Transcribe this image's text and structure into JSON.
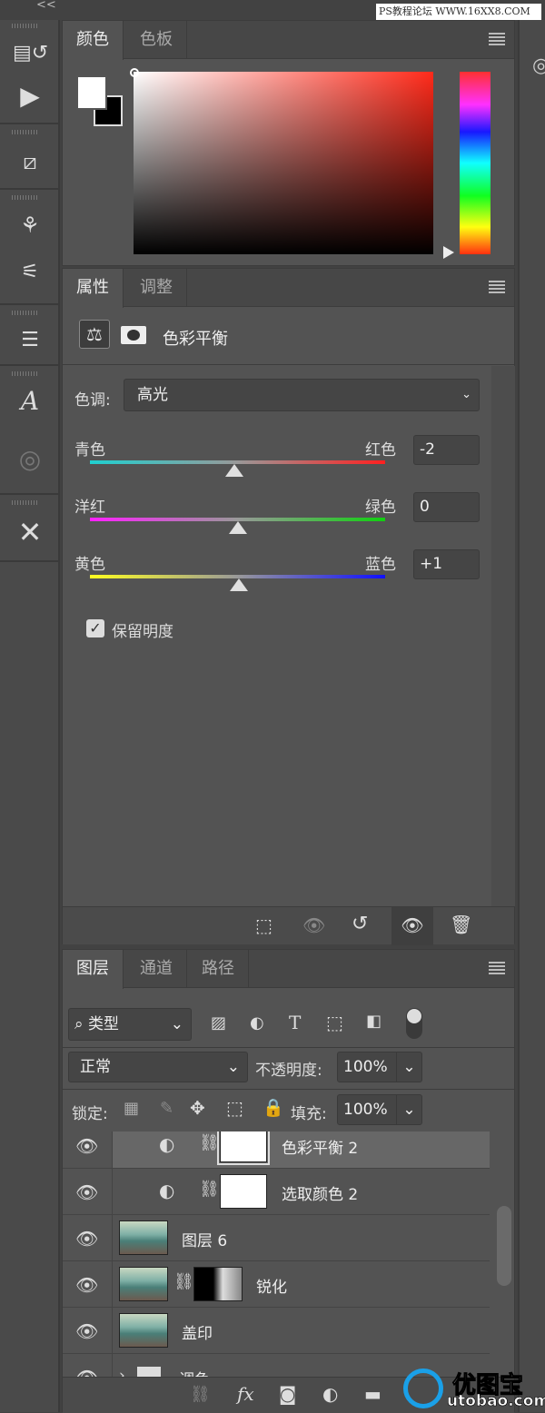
{
  "watermark_top": "PS教程论坛 WWW.16XX8.COM",
  "watermark_bottom": {
    "brand": "优图宝",
    "url": "utobao.com"
  },
  "collapse": "<<",
  "toolbar": {
    "icons": [
      "history-icon",
      "play-actions-icon",
      "transform-icon",
      "brush-presets-icon",
      "brush-settings-icon",
      "clone-source-icon",
      "character-icon",
      "3d-icon",
      "tools-icon"
    ]
  },
  "color_panel": {
    "tabs": [
      "颜色",
      "色板"
    ],
    "foreground": "#ffffff",
    "background": "#000000",
    "hue": "#ff2a1a"
  },
  "properties_panel": {
    "tabs": [
      "属性",
      "调整"
    ],
    "title": "色彩平衡",
    "tone_label": "色调:",
    "tone_value": "高光",
    "sliders": [
      {
        "left": "青色",
        "right": "红色",
        "value": "-2",
        "fraction": 0.49,
        "from": "#1fd0d0",
        "to": "#ff2020"
      },
      {
        "left": "洋红",
        "right": "绿色",
        "value": "0",
        "fraction": 0.5,
        "from": "#ff20ff",
        "to": "#10d010"
      },
      {
        "left": "黄色",
        "right": "蓝色",
        "value": "+1",
        "fraction": 0.505,
        "from": "#ffff20",
        "to": "#1010ff"
      }
    ],
    "preserve_luminosity": "保留明度",
    "preserve_checked": true
  },
  "layers_panel": {
    "tabs": [
      "图层",
      "通道",
      "路径"
    ],
    "filter": "类型",
    "blend_mode": "正常",
    "opacity_label": "不透明度:",
    "opacity": "100%",
    "lock_label": "锁定:",
    "fill_label": "填充:",
    "fill": "100%",
    "layers": [
      {
        "name": "色彩平衡 2",
        "type": "adjustment",
        "selected": true
      },
      {
        "name": "选取颜色 2",
        "type": "adjustment"
      },
      {
        "name": "图层 6",
        "type": "pixel"
      },
      {
        "name": "锐化",
        "type": "pixel-mask"
      },
      {
        "name": "盖印",
        "type": "pixel"
      },
      {
        "name": "调色",
        "type": "group"
      }
    ]
  }
}
